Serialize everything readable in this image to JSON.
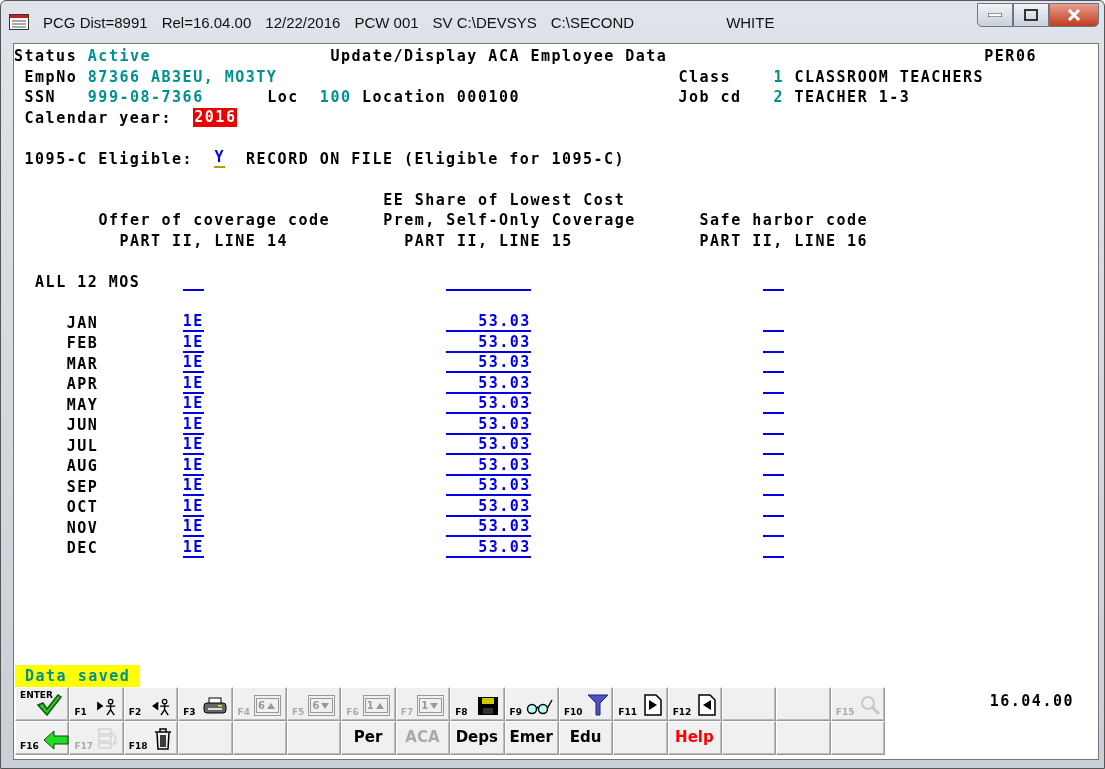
{
  "window": {
    "title_fields": [
      "PCG Dist=8991",
      "Rel=16.04.00",
      "12/22/2016",
      "PCW 001",
      "SV C:\\DEVSYS",
      "C:\\SECOND",
      "WHITE"
    ]
  },
  "header": {
    "status_label": "Status",
    "status": "Active",
    "screen_title": "Update/Display ACA Employee Data",
    "screen_id": "PER06",
    "empno_label": "EmpNo",
    "empno": "87366 AB3EU, MO3TY",
    "ssn_label": "SSN",
    "ssn": "999-08-7366",
    "loc_label": "Loc",
    "loc_code": "100",
    "loc_name": "Location 000100",
    "class_label": "Class",
    "class_code": "1",
    "class_name": "CLASSROOM TEACHERS",
    "job_label": "Job cd",
    "job_code": "2",
    "job_name": "TEACHER 1-3",
    "year_label": "Calendar year:",
    "year": "2016"
  },
  "eligibility": {
    "label": "1095-C Eligible:",
    "value": "Y",
    "message": "RECORD ON FILE (Eligible for 1095-C)"
  },
  "columns": [
    {
      "lines": [
        "Offer of coverage code",
        "PART II, LINE 14"
      ]
    },
    {
      "lines": [
        "EE Share of Lowest Cost",
        "Prem, Self-Only Coverage",
        "PART II, LINE 15"
      ]
    },
    {
      "lines": [
        "Safe harbor code",
        "PART II, LINE 16"
      ]
    }
  ],
  "all_months": {
    "label": "ALL 12 MOS"
  },
  "months": [
    {
      "month": "JAN",
      "offer_code": "1E",
      "ee_share": "53.03"
    },
    {
      "month": "FEB",
      "offer_code": "1E",
      "ee_share": "53.03"
    },
    {
      "month": "MAR",
      "offer_code": "1E",
      "ee_share": "53.03"
    },
    {
      "month": "APR",
      "offer_code": "1E",
      "ee_share": "53.03"
    },
    {
      "month": "MAY",
      "offer_code": "1E",
      "ee_share": "53.03"
    },
    {
      "month": "JUN",
      "offer_code": "1E",
      "ee_share": "53.03"
    },
    {
      "month": "JUL",
      "offer_code": "1E",
      "ee_share": "53.03"
    },
    {
      "month": "AUG",
      "offer_code": "1E",
      "ee_share": "53.03"
    },
    {
      "month": "SEP",
      "offer_code": "1E",
      "ee_share": "53.03"
    },
    {
      "month": "OCT",
      "offer_code": "1E",
      "ee_share": "53.03"
    },
    {
      "month": "NOV",
      "offer_code": "1E",
      "ee_share": "53.03"
    },
    {
      "month": "DEC",
      "offer_code": "1E",
      "ee_share": "53.03"
    }
  ],
  "message": "Data saved",
  "key_rows": [
    [
      {
        "kind": "icon",
        "key": "ENTER",
        "disabled": false
      },
      {
        "kind": "icon",
        "key": "F1",
        "disabled": false
      },
      {
        "kind": "icon",
        "key": "F2",
        "disabled": false
      },
      {
        "kind": "icon",
        "key": "F3",
        "disabled": false
      },
      {
        "kind": "icon",
        "key": "F4",
        "badge": "6",
        "disabled": true
      },
      {
        "kind": "icon",
        "key": "F5",
        "badge": "6",
        "disabled": true
      },
      {
        "kind": "icon",
        "key": "F6",
        "badge": "1",
        "disabled": true
      },
      {
        "kind": "icon",
        "key": "F7",
        "badge": "1",
        "disabled": true
      },
      {
        "kind": "icon",
        "key": "F8",
        "disabled": false
      },
      {
        "kind": "icon",
        "key": "F9",
        "disabled": false
      },
      {
        "kind": "icon",
        "key": "F10",
        "disabled": false
      },
      {
        "kind": "icon",
        "key": "F11",
        "disabled": false
      },
      {
        "kind": "icon",
        "key": "F12",
        "disabled": false
      },
      {
        "kind": "blank"
      },
      {
        "kind": "blank"
      },
      {
        "kind": "icon",
        "key": "F15",
        "disabled": true
      }
    ],
    [
      {
        "kind": "icon",
        "key": "F16",
        "disabled": false
      },
      {
        "kind": "icon",
        "key": "F17",
        "disabled": true
      },
      {
        "kind": "icon",
        "key": "F18",
        "disabled": false
      },
      {
        "kind": "blank"
      },
      {
        "kind": "blank"
      },
      {
        "kind": "blank"
      },
      {
        "kind": "text",
        "label": "Per",
        "disabled": false,
        "alert": false
      },
      {
        "kind": "text",
        "label": "ACA",
        "disabled": true,
        "alert": false
      },
      {
        "kind": "text",
        "label": "Deps",
        "disabled": false,
        "alert": false
      },
      {
        "kind": "text",
        "label": "Emer",
        "disabled": false,
        "alert": false
      },
      {
        "kind": "text",
        "label": "Edu",
        "disabled": false,
        "alert": false
      },
      {
        "kind": "blank"
      },
      {
        "kind": "text",
        "label": "Help",
        "disabled": false,
        "alert": true
      },
      {
        "kind": "blank"
      },
      {
        "kind": "blank"
      },
      {
        "kind": "blank"
      }
    ]
  ],
  "version": "16.04.00"
}
